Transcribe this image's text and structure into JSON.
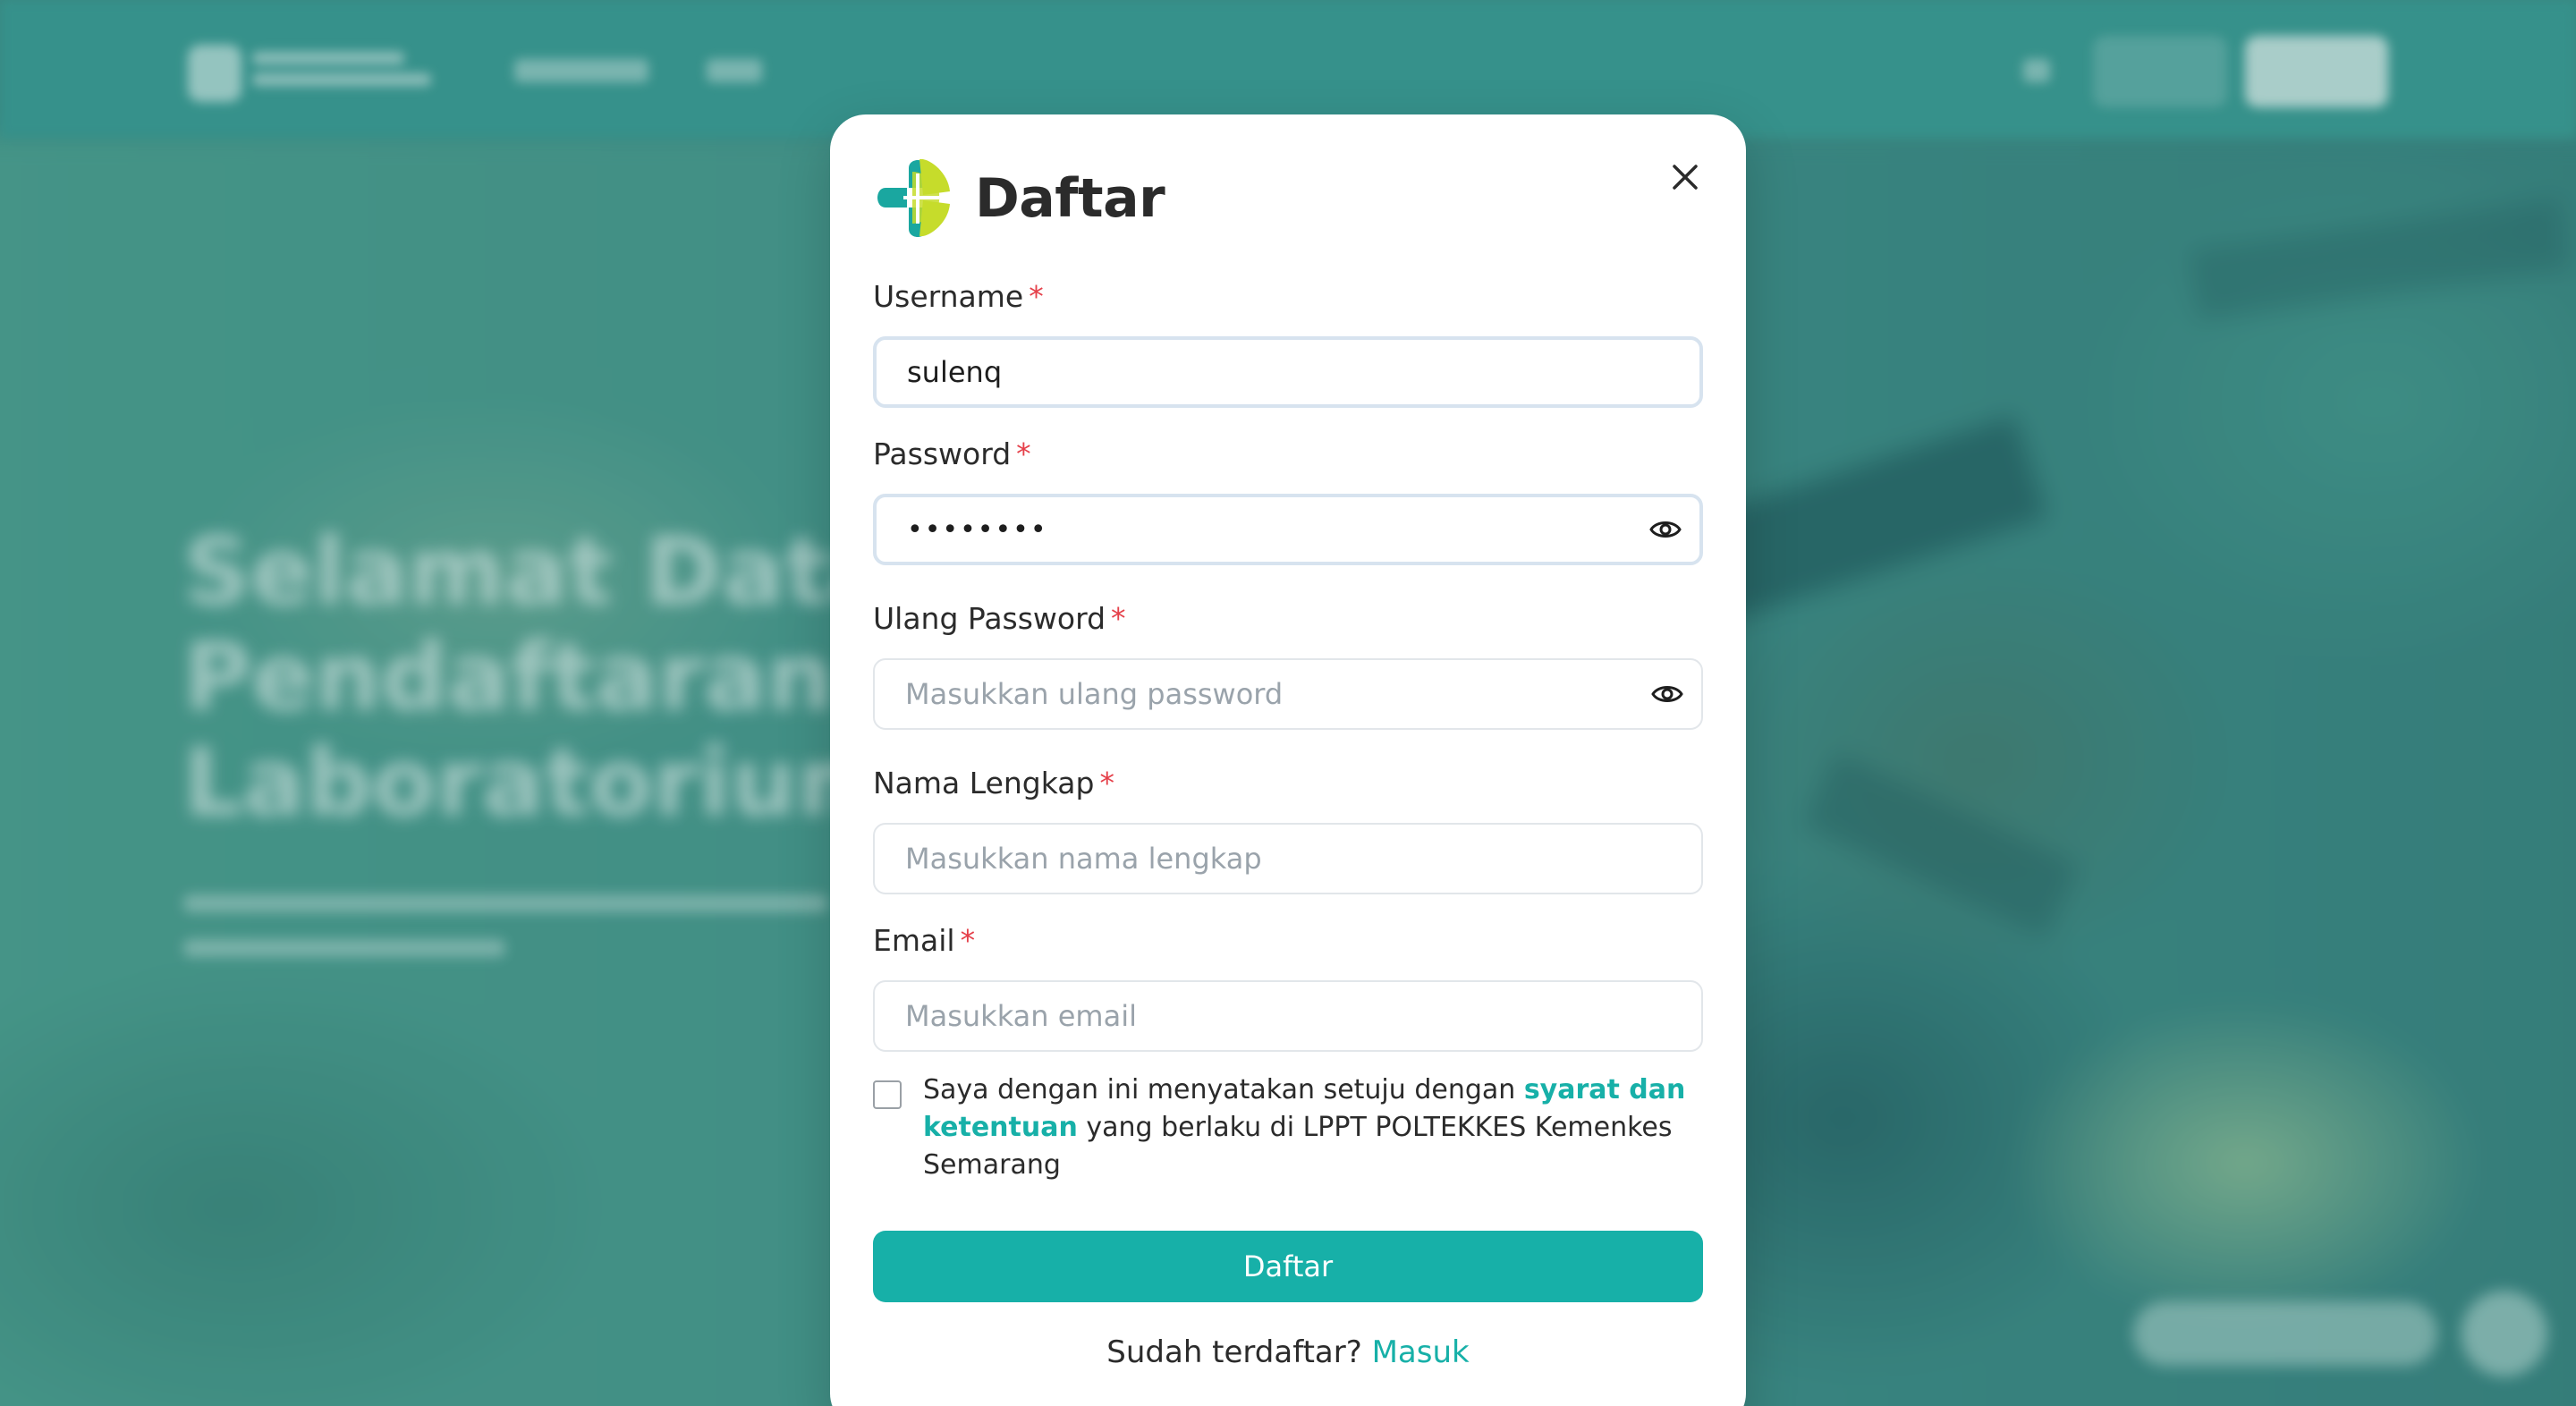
{
  "background": {
    "hero_lines": [
      "Selamat Data",
      "Pendaftaran I",
      "Laboratorium"
    ]
  },
  "modal": {
    "title": "Daftar",
    "close_icon": "close-icon",
    "fields": [
      {
        "label": "Username",
        "required": "*",
        "value": "sulenq",
        "placeholder": ""
      },
      {
        "label": "Password",
        "required": "*",
        "value": "••••••••",
        "placeholder": ""
      },
      {
        "label": "Ulang Password",
        "required": "*",
        "value": "",
        "placeholder": "Masukkan ulang password"
      },
      {
        "label": "Nama Lengkap",
        "required": "*",
        "value": "",
        "placeholder": "Masukkan nama lengkap"
      },
      {
        "label": "Email",
        "required": "*",
        "value": "",
        "placeholder": "Masukkan email"
      }
    ],
    "terms": {
      "before": "Saya dengan ini menyatakan setuju dengan ",
      "link": "syarat dan ketentuan",
      "after": " yang berlaku di LPPT POLTEKKES Kemenkes Semarang",
      "checked": false
    },
    "submit_label": "Daftar",
    "login_prompt": "Sudah terdaftar? ",
    "login_link": "Masuk"
  },
  "colors": {
    "accent": "#17b0a8",
    "required": "#e5404a",
    "logo_teal": "#1aa7a0",
    "logo_lime": "#c6dc2b"
  }
}
